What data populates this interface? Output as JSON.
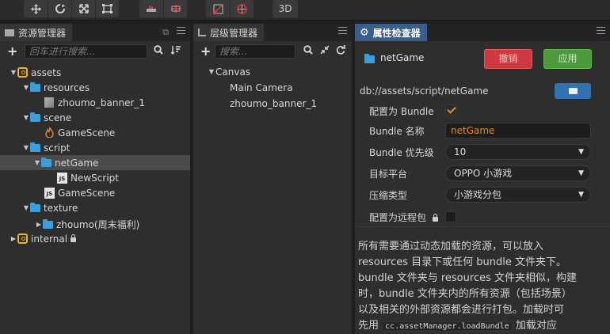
{
  "toolbar": {
    "mode_3d": "3D"
  },
  "assets_panel": {
    "title": "资源管理器",
    "search_placeholder": "回车进行搜索...",
    "tree": [
      {
        "label": "assets",
        "icon": "package-icon",
        "arrow": "▼"
      },
      {
        "label": "resources",
        "icon": "folder-icon",
        "arrow": "▼"
      },
      {
        "label": "zhoumo_banner_1",
        "icon": "prefab-icon",
        "arrow": ""
      },
      {
        "label": "scene",
        "icon": "folder-icon",
        "arrow": "▼"
      },
      {
        "label": "GameScene",
        "icon": "scene-icon",
        "arrow": ""
      },
      {
        "label": "script",
        "icon": "folder-icon",
        "arrow": "▼"
      },
      {
        "label": "netGame",
        "icon": "folder-icon",
        "arrow": "▼",
        "selected": true
      },
      {
        "label": "NewScript",
        "icon": "js-icon",
        "arrow": ""
      },
      {
        "label": "GameScene",
        "icon": "js-icon",
        "arrow": ""
      },
      {
        "label": "texture",
        "icon": "folder-icon",
        "arrow": "▼"
      },
      {
        "label": "zhoumo(周末福利)",
        "icon": "folder-icon",
        "arrow": "▶"
      },
      {
        "label": "internal",
        "icon": "package-icon",
        "arrow": "▶",
        "locked": true
      }
    ],
    "js_badge": "JS"
  },
  "hierarchy_panel": {
    "title": "层级管理器",
    "search_placeholder": "搜索...",
    "tree": [
      {
        "label": "Canvas",
        "arrow": "▼"
      },
      {
        "label": "Main Camera",
        "arrow": ""
      },
      {
        "label": "zhoumo_banner_1",
        "arrow": ""
      }
    ]
  },
  "inspector_panel": {
    "title": "属性检查器",
    "asset_name": "netGame",
    "revert_label": "撤销",
    "apply_label": "应用",
    "path": "db://assets/script/netGame",
    "props": {
      "is_bundle_label": "配置为 Bundle",
      "is_bundle": true,
      "bundle_name_label": "Bundle 名称",
      "bundle_name": "netGame",
      "priority_label": "Bundle 优先级",
      "priority": "10",
      "platform_label": "目标平台",
      "platform": "OPPO 小游戏",
      "compression_label": "压缩类型",
      "compression": "小游戏分包",
      "remote_label": "配置为远程包",
      "remote": false
    },
    "description": {
      "line1": "所有需要通过动态加载的资源，可以放入",
      "line2": "resources 目录下或任何 bundle 文件夹下。",
      "line3": "bundle 文件夹与 resources 文件夹相似，构建",
      "line4": "时，bundle 文件夹内的所有资源（包括场景）",
      "line5": "以及相关的外部资源都会进行打包。加载时可",
      "line6_pre": "先用",
      "line6_code": "cc.assetManager.loadBundle",
      "line6_post": "加载对应"
    }
  },
  "colors": {
    "revert_button": "#d0383f",
    "apply_button": "#4c9a3e",
    "folder": "#3c9ddb",
    "accent_text": "#e08a2c",
    "active_tab": "#3a5d8a"
  }
}
